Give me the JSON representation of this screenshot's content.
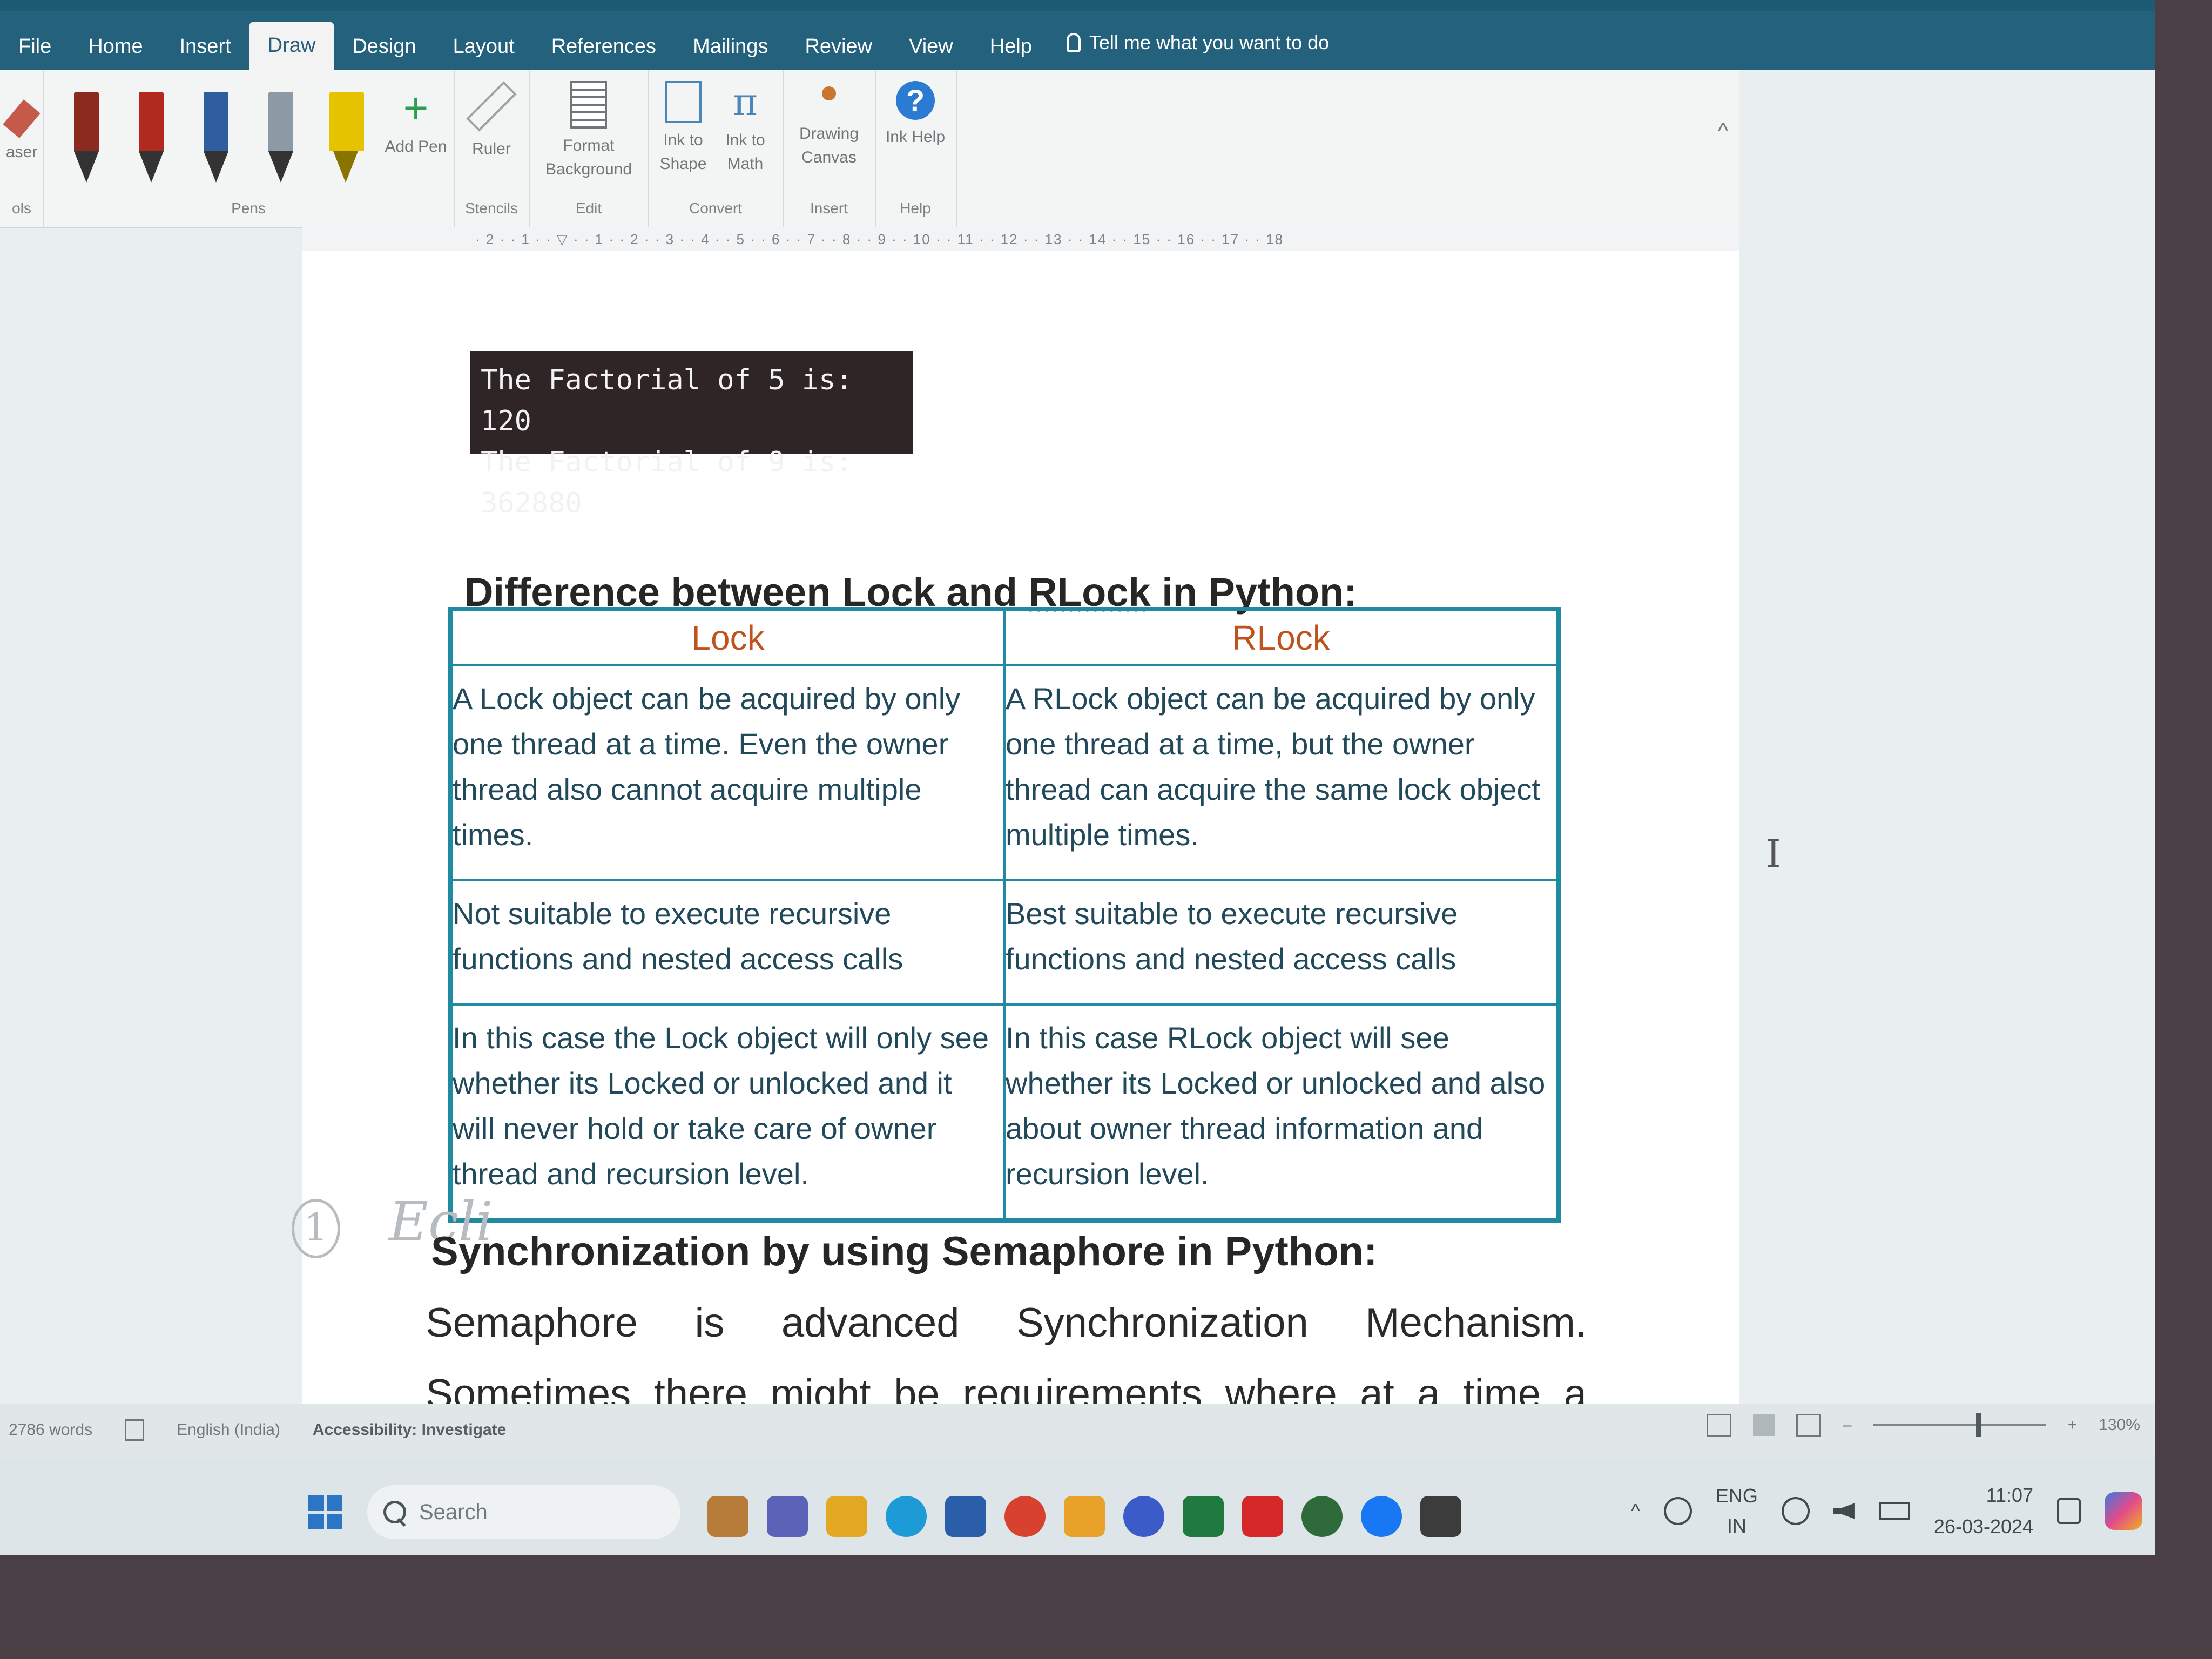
{
  "ribbon": {
    "tabs": [
      "File",
      "Home",
      "Insert",
      "Draw",
      "Design",
      "Layout",
      "References",
      "Mailings",
      "Review",
      "View",
      "Help"
    ],
    "active_tab": "Draw",
    "tell_me": "Tell me what you want to do",
    "eraser_label": "aser",
    "tools_group": "ols",
    "pens_group": "Pens",
    "add_pen": "Add Pen",
    "ruler": "Ruler",
    "stencils_group": "Stencils",
    "format_background": "Format Background",
    "edit_group": "Edit",
    "ink_to_shape": "Ink to Shape",
    "ink_to_math": "Ink to Math",
    "convert_group": "Convert",
    "drawing_canvas": "Drawing Canvas",
    "insert_group": "Insert",
    "ink_help": "Ink Help",
    "help_group": "Help",
    "pen_colors": [
      "#8b2a1e",
      "#b02a20",
      "#2f5e9e",
      "#8c9aa6",
      "#e6c300"
    ]
  },
  "ruler": {
    "ticks": "· 2 · · 1 · · ▽ · · 1 · · 2 · · 3 · · 4 · · 5 · · 6 · · 7 · · 8 · · 9 · · 10 · · 11 · · 12 · · 13 · · 14 · · 15 · · 16 · · 17 · · 18"
  },
  "document": {
    "console_lines": [
      "The Factorial of 5 is: 120",
      "The Factorial of 9 is: 362880"
    ],
    "heading1_pre": "Difference between Lock and ",
    "heading1_spell": "RLock",
    "heading1_post": " in Python:",
    "table": {
      "headers": [
        "Lock",
        "RLock"
      ],
      "rows": [
        [
          "A Lock object can be acquired by only one thread at a time. Even the owner thread also cannot acquire multiple times.",
          "A RLock object can be acquired by only one thread at a time, but the owner thread can acquire the same lock object multiple times."
        ],
        [
          "Not suitable to execute recursive functions and nested access calls",
          "Best suitable to execute recursive functions and nested access calls"
        ],
        [
          "In this case the Lock object will only see whether its Locked or unlocked and it will never hold or take care of owner thread and recursion level.",
          "In this case RLock object will see whether its Locked or unlocked and also about owner thread information and recursion level."
        ]
      ]
    },
    "handwriting_num": "1",
    "handwriting_text": "Ecli",
    "heading2": "Synchronization by using Semaphore in Python:",
    "paragraph": "Semaphore is advanced Synchronization Mechanism. Sometimes there might be requirements where at a time a particular number of"
  },
  "status": {
    "words": "2786 words",
    "language": "English (India)",
    "accessibility": "Accessibility: Investigate",
    "zoom": "130%"
  },
  "taskbar": {
    "search": "Search",
    "lang_top": "ENG",
    "lang_bottom": "IN",
    "time": "11:07",
    "date": "26-03-2024"
  }
}
